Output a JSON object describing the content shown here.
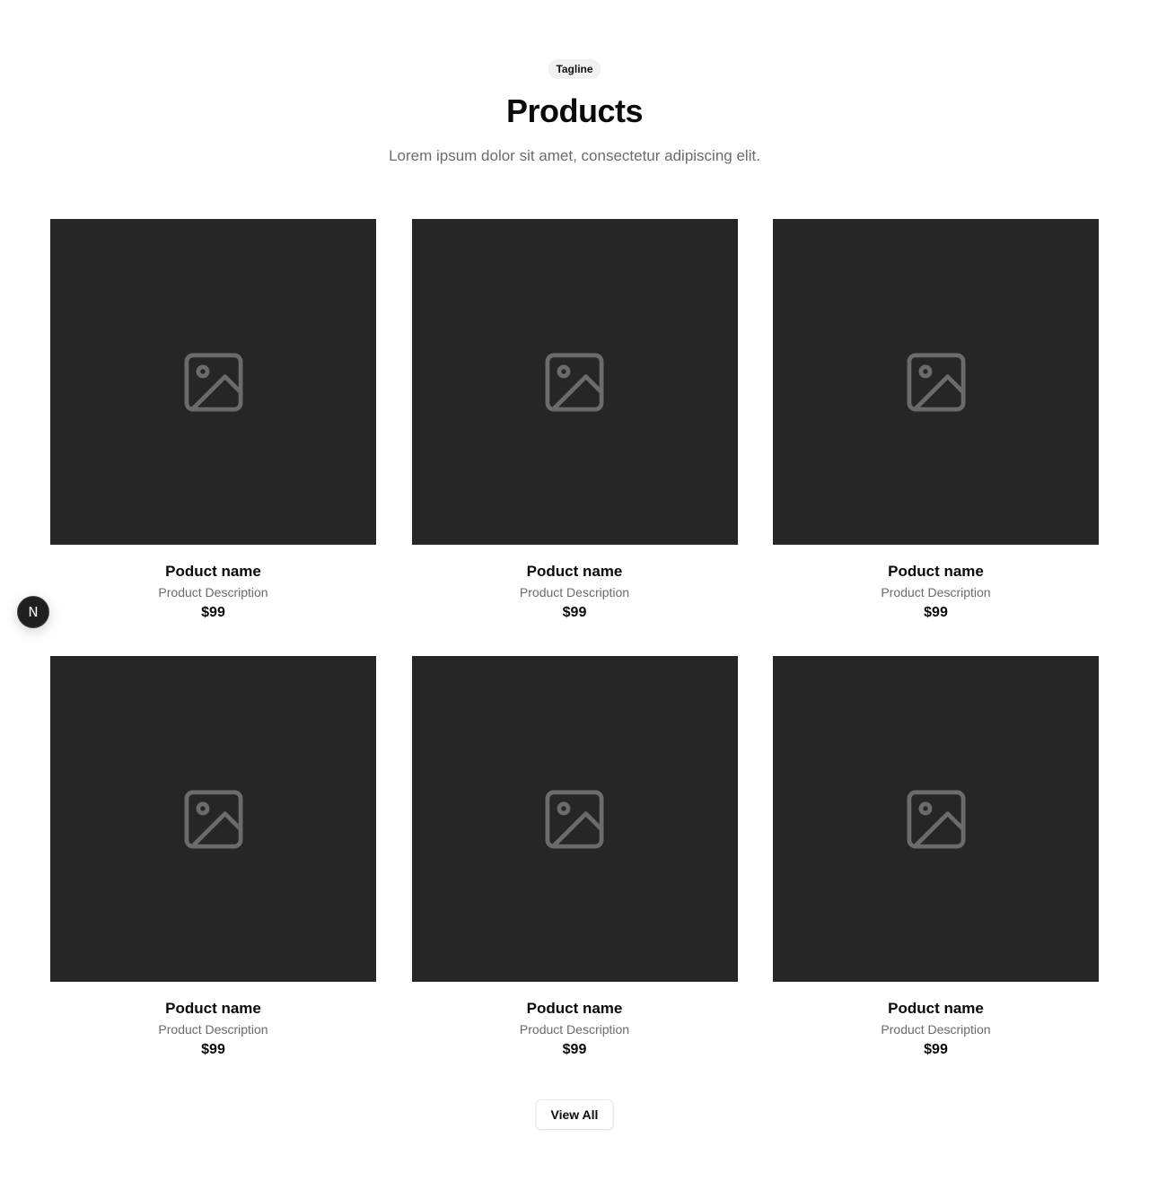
{
  "header": {
    "tagline": "Tagline",
    "title": "Products",
    "subtitle": "Lorem ipsum dolor sit amet, consectetur adipiscing elit."
  },
  "products": [
    {
      "name": "Poduct name",
      "description": "Product Description",
      "price": "$99",
      "image_icon": "image-placeholder-icon"
    },
    {
      "name": "Poduct name",
      "description": "Product Description",
      "price": "$99",
      "image_icon": "image-placeholder-icon"
    },
    {
      "name": "Poduct name",
      "description": "Product Description",
      "price": "$99",
      "image_icon": "image-placeholder-icon"
    },
    {
      "name": "Poduct name",
      "description": "Product Description",
      "price": "$99",
      "image_icon": "image-placeholder-icon"
    },
    {
      "name": "Poduct name",
      "description": "Product Description",
      "price": "$99",
      "image_icon": "image-placeholder-icon"
    },
    {
      "name": "Poduct name",
      "description": "Product Description",
      "price": "$99",
      "image_icon": "image-placeholder-icon"
    }
  ],
  "actions": {
    "view_all_label": "View All"
  },
  "dev_badge": {
    "letter": "N",
    "icon": "nextjs-dev-indicator-icon"
  },
  "colors": {
    "image_background": "#262626",
    "icon_stroke": "#6b6b6b",
    "muted_text": "#6b6b6b",
    "tagline_background": "#f1f1f1"
  }
}
